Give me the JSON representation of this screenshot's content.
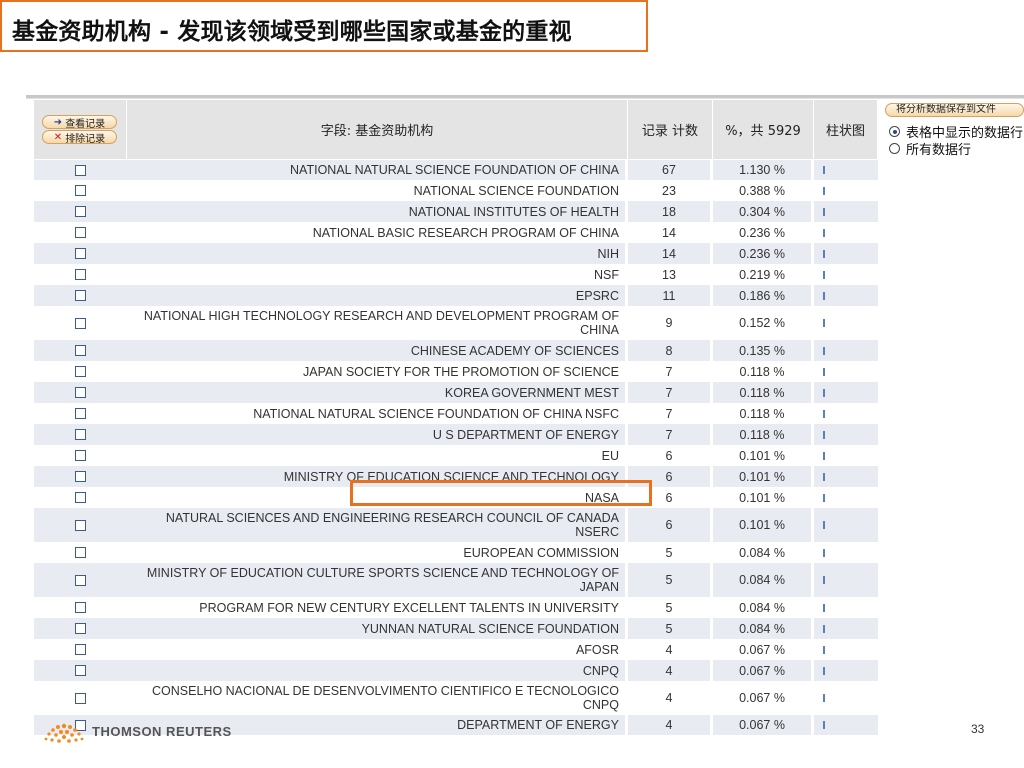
{
  "title": "基金资助机构 - 发现该领域受到哪些国家或基金的重视",
  "buttons": {
    "view_records": "查看记录",
    "exclude_records": "排除记录",
    "save_to_file": "将分析数据保存到文件"
  },
  "headers": {
    "field": "字段: 基金资助机构",
    "count": "记录 计数",
    "percent": "%，共 5929",
    "bar": "柱状图"
  },
  "options": {
    "displayed_rows": "表格中显示的数据行",
    "all_rows": "所有数据行",
    "selected": "displayed_rows"
  },
  "rows": [
    {
      "name": "NATIONAL NATURAL SCIENCE FOUNDATION OF CHINA",
      "count": "67",
      "percent": "1.130 %"
    },
    {
      "name": "NATIONAL SCIENCE FOUNDATION",
      "count": "23",
      "percent": "0.388 %"
    },
    {
      "name": "NATIONAL INSTITUTES OF HEALTH",
      "count": "18",
      "percent": "0.304 %"
    },
    {
      "name": "NATIONAL BASIC RESEARCH PROGRAM OF CHINA",
      "count": "14",
      "percent": "0.236 %"
    },
    {
      "name": "NIH",
      "count": "14",
      "percent": "0.236 %"
    },
    {
      "name": "NSF",
      "count": "13",
      "percent": "0.219 %"
    },
    {
      "name": "EPSRC",
      "count": "11",
      "percent": "0.186 %"
    },
    {
      "name": "NATIONAL HIGH TECHNOLOGY RESEARCH AND DEVELOPMENT PROGRAM OF CHINA",
      "count": "9",
      "percent": "0.152 %"
    },
    {
      "name": "CHINESE ACADEMY OF SCIENCES",
      "count": "8",
      "percent": "0.135 %"
    },
    {
      "name": "JAPAN SOCIETY FOR THE PROMOTION OF SCIENCE",
      "count": "7",
      "percent": "0.118 %"
    },
    {
      "name": "KOREA GOVERNMENT MEST",
      "count": "7",
      "percent": "0.118 %"
    },
    {
      "name": "NATIONAL NATURAL SCIENCE FOUNDATION OF CHINA NSFC",
      "count": "7",
      "percent": "0.118 %"
    },
    {
      "name": "U S DEPARTMENT OF ENERGY",
      "count": "7",
      "percent": "0.118 %"
    },
    {
      "name": "EU",
      "count": "6",
      "percent": "0.101 %"
    },
    {
      "name": "MINISTRY OF EDUCATION SCIENCE AND TECHNOLOGY",
      "count": "6",
      "percent": "0.101 %"
    },
    {
      "name": "NASA",
      "count": "6",
      "percent": "0.101 %"
    },
    {
      "name": "NATURAL SCIENCES AND ENGINEERING RESEARCH COUNCIL OF CANADA NSERC",
      "count": "6",
      "percent": "0.101 %"
    },
    {
      "name": "EUROPEAN COMMISSION",
      "count": "5",
      "percent": "0.084 %"
    },
    {
      "name": "MINISTRY OF EDUCATION CULTURE SPORTS SCIENCE AND TECHNOLOGY OF JAPAN",
      "count": "5",
      "percent": "0.084 %"
    },
    {
      "name": "PROGRAM FOR NEW CENTURY EXCELLENT TALENTS IN UNIVERSITY",
      "count": "5",
      "percent": "0.084 %"
    },
    {
      "name": "YUNNAN NATURAL SCIENCE FOUNDATION",
      "count": "5",
      "percent": "0.084 %"
    },
    {
      "name": "AFOSR",
      "count": "4",
      "percent": "0.067 %"
    },
    {
      "name": "CNPQ",
      "count": "4",
      "percent": "0.067 %"
    },
    {
      "name": "CONSELHO NACIONAL DE DESENVOLVIMENTO CIENTIFICO E TECNOLOGICO CNPQ",
      "count": "4",
      "percent": "0.067 %"
    },
    {
      "name": "DEPARTMENT OF ENERGY",
      "count": "4",
      "percent": "0.067 %"
    }
  ],
  "footer": {
    "brand": "THOMSON REUTERS",
    "page": "33"
  },
  "colors": {
    "accent": "#e8711f",
    "row_alt": "#e8ecf2",
    "header": "#e4e4e4",
    "bar": "#5a7fbf"
  }
}
